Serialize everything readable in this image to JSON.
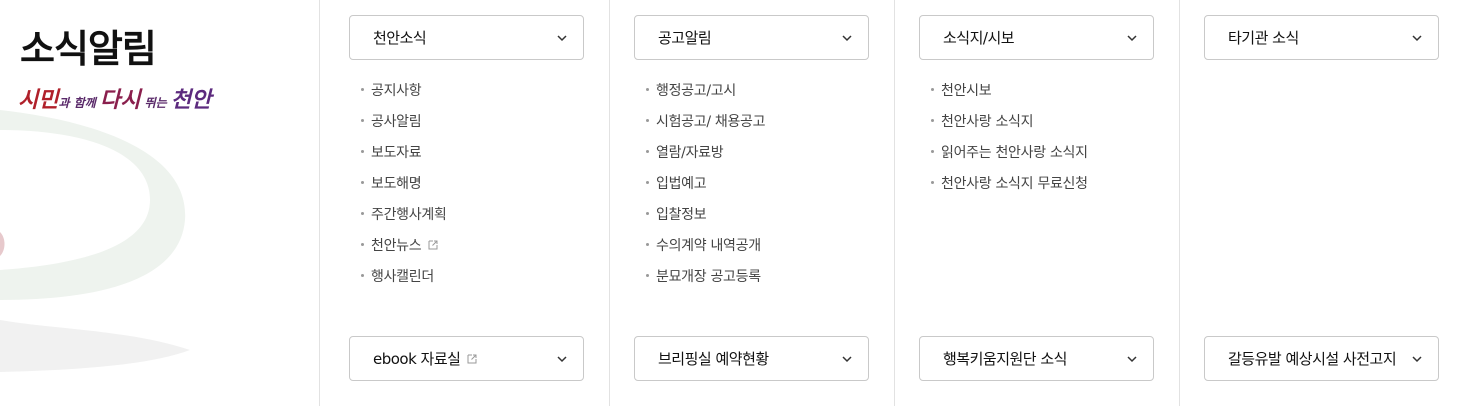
{
  "section": {
    "title": "소식알림",
    "slogan": {
      "part1": "시민",
      "part2": "과 함께 ",
      "part3": "다시",
      "part4": " 뛰는 ",
      "part5": "천안"
    }
  },
  "columns": [
    {
      "select_label": "천안소식",
      "items": [
        {
          "label": "공지사항",
          "external": false
        },
        {
          "label": "공사알림",
          "external": false
        },
        {
          "label": "보도자료",
          "external": false
        },
        {
          "label": "보도해명",
          "external": false
        },
        {
          "label": "주간행사계획",
          "external": false
        },
        {
          "label": "천안뉴스",
          "external": true
        },
        {
          "label": "행사캘린더",
          "external": false
        }
      ],
      "bottom_select_label": "ebook 자료실",
      "bottom_external": true
    },
    {
      "select_label": "공고알림",
      "items": [
        {
          "label": "행정공고/고시",
          "external": false
        },
        {
          "label": "시험공고/ 채용공고",
          "external": false
        },
        {
          "label": "열람/자료방",
          "external": false
        },
        {
          "label": "입법예고",
          "external": false
        },
        {
          "label": "입찰정보",
          "external": false
        },
        {
          "label": "수의계약 내역공개",
          "external": false
        },
        {
          "label": "분묘개장 공고등록",
          "external": false
        }
      ],
      "bottom_select_label": "브리핑실 예약현황",
      "bottom_external": false
    },
    {
      "select_label": "소식지/시보",
      "items": [
        {
          "label": "천안시보",
          "external": false
        },
        {
          "label": "천안사랑 소식지",
          "external": false
        },
        {
          "label": "읽어주는 천안사랑 소식지",
          "external": false
        },
        {
          "label": "천안사랑 소식지 무료신청",
          "external": false
        }
      ],
      "bottom_select_label": "행복키움지원단 소식",
      "bottom_external": false
    },
    {
      "select_label": "타기관 소식",
      "items": [],
      "bottom_select_label": "갈등유발 예상시설 사전고지",
      "bottom_external": false
    }
  ],
  "icons": {
    "chevron": "chevron-down-icon",
    "external": "external-link-icon"
  },
  "colors": {
    "border": "#c9c9c9",
    "divider": "#e2e2e2",
    "slogan_red": "#b0202a",
    "slogan_purple": "#5c2a7e"
  }
}
